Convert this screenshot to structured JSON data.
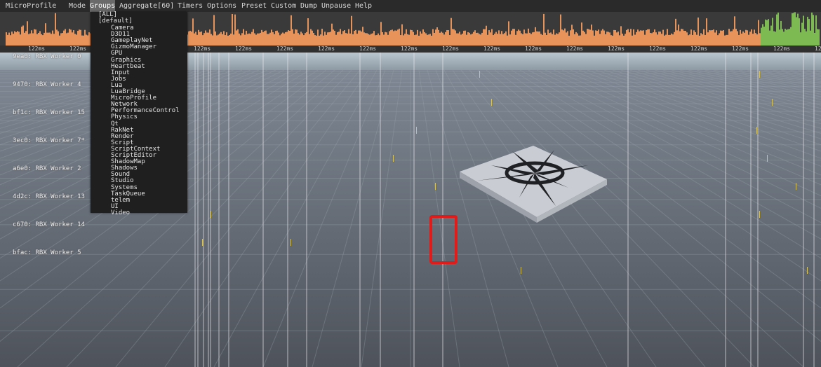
{
  "app_title": "MicroProfile",
  "menu": [
    "Mode",
    "Groups",
    "Aggregate[60]",
    "Timers",
    "Options",
    "Preset",
    "Custom",
    "Dump",
    "Unpause",
    "Help"
  ],
  "active_menu": "Groups",
  "groups_menu": {
    "top_items": [
      "[ALL]",
      "[default]"
    ],
    "items": [
      "Camera",
      "D3D11",
      "GameplayNet",
      "GizmoManager",
      "GPU",
      "Graphics",
      "Heartbeat",
      "Input",
      "Jobs",
      "Lua",
      "LuaBridge",
      "MicroProfile",
      "Network",
      "PerformanceControl",
      "Physics",
      "Qt",
      "RakNet",
      "Render",
      "Script",
      "ScriptContext",
      "ScriptEditor",
      "ShadowMap",
      "Shadows",
      "Sound",
      "Studio",
      "Systems",
      "TaskQueue",
      "telem",
      "UI",
      "Video"
    ]
  },
  "timeline": {
    "tick_label": "122ms",
    "tick_count": 20
  },
  "threads": [
    {
      "id": "9ea0",
      "name": "RBX Worker 0"
    },
    {
      "id": "9470",
      "name": "RBX Worker 4"
    },
    {
      "id": "bf1c",
      "name": "RBX Worker 15"
    },
    {
      "id": "3ec0",
      "name": "RBX Worker 7*"
    },
    {
      "id": "a6e0",
      "name": "RBX Worker 2"
    },
    {
      "id": "4d2c",
      "name": "RBX Worker 13"
    },
    {
      "id": "c670",
      "name": "RBX Worker 14"
    },
    {
      "id": "bfac",
      "name": "RBX Worker 5"
    }
  ],
  "colors": {
    "graph_orange": "#e8935a",
    "graph_green": "#7dbb52",
    "highlight_red": "#e11a1a",
    "menu_bg": "#1f1f1f"
  }
}
